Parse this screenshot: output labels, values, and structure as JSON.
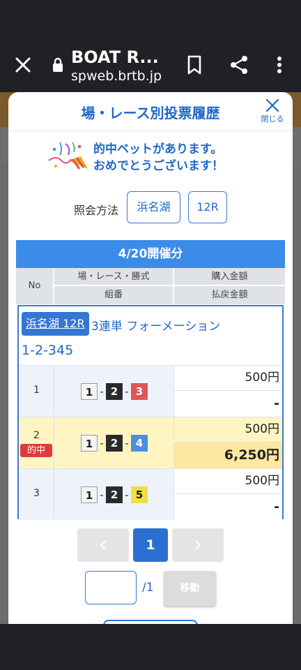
{
  "browser": {
    "page_title": "BOAT R...",
    "url": "spweb.brtb.jp"
  },
  "modal": {
    "title": "場・レース別投票履歴",
    "close_label": "閉じる",
    "congrats_line1": "的中ベットがあります。",
    "congrats_line2": "おめでとうございます！",
    "query_label": "照会方法",
    "query_place": "浜名湖",
    "query_race": "12R"
  },
  "table": {
    "date_header": "4/20開催分",
    "headers": {
      "no": "No",
      "race": "場・レース・勝式",
      "combo": "組番",
      "purchase": "購入金額",
      "payout": "払戻金額"
    }
  },
  "ticket": {
    "place_race": "浜名湖 12R",
    "bet_type": "3連単 フォーメーション",
    "formation": "1-2-345",
    "hit_label": "的中",
    "rows": [
      {
        "no": "1",
        "b1": "1",
        "b2": "2",
        "b3": "3",
        "dash": "-",
        "purchase": "500円",
        "payout": "-"
      },
      {
        "no": "2",
        "b1": "1",
        "b2": "2",
        "b3": "4",
        "dash": "-",
        "purchase": "500円",
        "payout": "6,250円"
      },
      {
        "no": "3",
        "b1": "1",
        "b2": "2",
        "b3": "5",
        "dash": "-",
        "purchase": "500円",
        "payout": "-"
      }
    ]
  },
  "pagination": {
    "current_page": "1",
    "total": "/1",
    "move_label": "移動"
  },
  "colors": {
    "accent": "#2168c8",
    "header_bar": "#3a8ce8",
    "hit_badge": "#dc3b3b",
    "hit_row": "#fff5c2"
  }
}
